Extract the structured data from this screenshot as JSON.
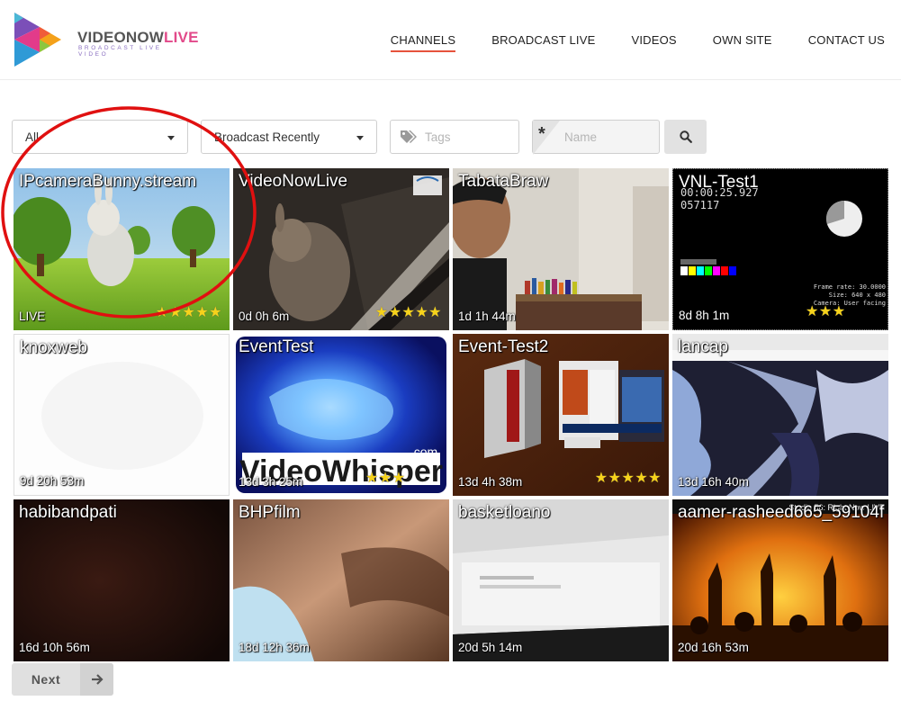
{
  "brand": {
    "name_part1": "VIDEONOW",
    "name_part2": "LIVE",
    "tagline": "BROADCAST LIVE VIDEO"
  },
  "nav": [
    {
      "label": "CHANNELS",
      "active": true
    },
    {
      "label": "BROADCAST LIVE",
      "active": false
    },
    {
      "label": "VIDEOS",
      "active": false
    },
    {
      "label": "OWN SITE",
      "active": false
    },
    {
      "label": "CONTACT US",
      "active": false
    }
  ],
  "filters": {
    "category": "All",
    "order": "Broadcast Recently",
    "tags_placeholder": "Tags",
    "name_placeholder": "Name"
  },
  "channels": [
    {
      "title": "IPcameraBunny.stream",
      "age": "LIVE",
      "stars": "★★★★★"
    },
    {
      "title": "VideoNowLive",
      "age": "0d 0h 6m",
      "stars": "★★★★★"
    },
    {
      "title": "TabataBraw",
      "age": "1d 1h 44m",
      "stars": ""
    },
    {
      "title": "VNL-Test1",
      "age": "8d 8h 1m",
      "stars": "★★★"
    },
    {
      "title": "knoxweb",
      "age": "9d 20h 53m",
      "stars": ""
    },
    {
      "title": "EventTest",
      "age": "13d 3h 25m",
      "stars": "★★★"
    },
    {
      "title": "Event-Test2",
      "age": "13d 4h 38m",
      "stars": "★★★★★"
    },
    {
      "title": "lancap",
      "age": "13d 16h 40m",
      "stars": ""
    },
    {
      "title": "habibandpati",
      "age": "16d 10h 56m",
      "stars": ""
    },
    {
      "title": "BHPfilm",
      "age": "18d 12h 36m",
      "stars": ""
    },
    {
      "title": "basketloano",
      "age": "20d 5h 14m",
      "stars": ""
    },
    {
      "title": "aamer-rasheed665_59104f",
      "age": "20d 16h 53m",
      "stars": ""
    }
  ],
  "thumb_texts": {
    "test1_counter": "00:00:25.927",
    "test1_frame": "057117",
    "test1_info1": "Frame rate: 30.0000",
    "test1_info2": "Size: 640 x 480",
    "test1_info3": "Camera: User facing",
    "eventtest_logo": "VideoWhisper",
    "eventtest_com": ".com",
    "aamer_banner": "Studio 56: Right Now LIVE"
  },
  "pagination": {
    "next_label": "Next"
  },
  "colors": {
    "nav_active_underline": "#e6533c",
    "star": "#f6d21b",
    "annotation_circle": "#e01010"
  }
}
